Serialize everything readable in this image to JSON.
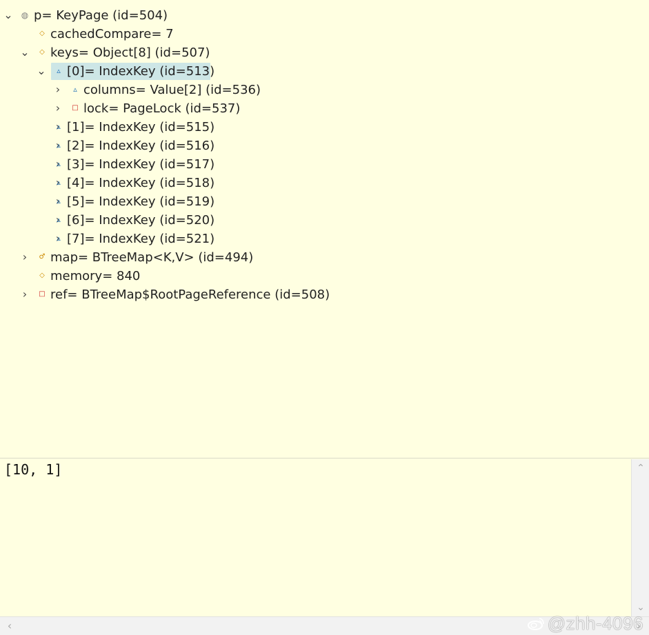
{
  "variables_tree": {
    "nodes": [
      {
        "label": "p= KeyPage  (id=504)",
        "icon": "default-object-icon",
        "state": "expanded"
      },
      {
        "label": "cachedCompare= 7",
        "icon": "field-icon",
        "state": "leaf"
      },
      {
        "label": "keys= Object[8]  (id=507)",
        "icon": "field-icon",
        "state": "expanded"
      },
      {
        "label": "[0]= IndexKey  (id=513)",
        "icon": "protected-field-icon",
        "state": "expanded",
        "selected": true
      },
      {
        "label": "columns= Value[2]  (id=536)",
        "icon": "protected-field-icon",
        "state": "collapsed"
      },
      {
        "label": "lock= PageLock  (id=537)",
        "icon": "private-field-icon",
        "state": "collapsed"
      },
      {
        "label": "[1]= IndexKey  (id=515)",
        "icon": "protected-field-icon",
        "state": "collapsed"
      },
      {
        "label": "[2]= IndexKey  (id=516)",
        "icon": "protected-field-icon",
        "state": "collapsed"
      },
      {
        "label": "[3]= IndexKey  (id=517)",
        "icon": "protected-field-icon",
        "state": "collapsed"
      },
      {
        "label": "[4]= IndexKey  (id=518)",
        "icon": "protected-field-icon",
        "state": "collapsed"
      },
      {
        "label": "[5]= IndexKey  (id=519)",
        "icon": "protected-field-icon",
        "state": "collapsed"
      },
      {
        "label": "[6]= IndexKey  (id=520)",
        "icon": "protected-field-icon",
        "state": "collapsed"
      },
      {
        "label": "[7]= IndexKey  (id=521)",
        "icon": "protected-field-icon",
        "state": "collapsed"
      },
      {
        "label": "map= BTreeMap<K,V>  (id=494)",
        "icon": "final-field-icon",
        "state": "collapsed"
      },
      {
        "label": "memory= 840",
        "icon": "field-icon",
        "state": "leaf"
      },
      {
        "label": "ref= BTreeMap$RootPageReference  (id=508)",
        "icon": "private-field-icon",
        "state": "collapsed"
      }
    ]
  },
  "detail_pane": {
    "value_text": "[10, 1]"
  },
  "scrollbars": {
    "up_icon": "chevron-up-icon",
    "down_icon": "chevron-down-icon",
    "left_icon": "chevron-left-icon",
    "right_icon": "chevron-right-icon"
  },
  "watermark": {
    "text": "@zhh-4096"
  },
  "colors": {
    "background": "#ffffe1",
    "selection": "#cde6e6",
    "field_icon": "#cc8a00",
    "protected_icon": "#1d6fb8",
    "private_icon": "#cc2222",
    "default_icon": "#808080"
  }
}
